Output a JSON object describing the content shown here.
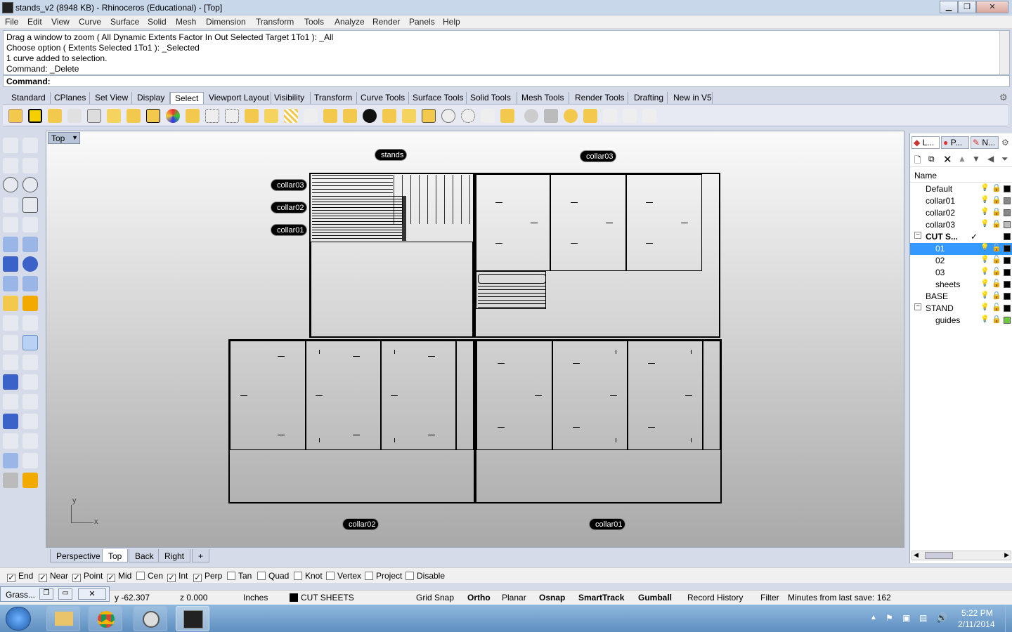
{
  "window": {
    "title": "stands_v2 (8948 KB) - Rhinoceros (Educational) - [Top]"
  },
  "menu": [
    "File",
    "Edit",
    "View",
    "Curve",
    "Surface",
    "Solid",
    "Mesh",
    "Dimension",
    "Transform",
    "Tools",
    "Analyze",
    "Render",
    "Panels",
    "Help"
  ],
  "history": [
    "Drag a window to zoom ( All  Dynamic  Extents  Factor  In  Out  Selected  Target  1To1 ): _All",
    "Choose option ( Extents  Selected  1To1 ): _Selected",
    "1 curve added to selection.",
    "Command: _Delete"
  ],
  "command_label": "Command:",
  "toolbar_tabs": [
    "Standard",
    "CPlanes",
    "Set View",
    "Display",
    "Select",
    "Viewport Layout",
    "Visibility",
    "Transform",
    "Curve Tools",
    "Surface Tools",
    "Solid Tools",
    "Mesh Tools",
    "Render Tools",
    "Drafting",
    "New in V5"
  ],
  "viewport": {
    "label": "Top",
    "labels": {
      "stands": "stands",
      "collar03_top": "collar03",
      "collar03": "collar03",
      "collar02": "collar02",
      "collar01": "collar01",
      "collar02_bottom": "collar02",
      "collar01_bottom": "collar01"
    },
    "axis_y": "y",
    "axis_x": "x"
  },
  "viewport_tabs": [
    "Perspective",
    "Top",
    "Back",
    "Right"
  ],
  "osnaps": [
    {
      "label": "End",
      "checked": true
    },
    {
      "label": "Near",
      "checked": true
    },
    {
      "label": "Point",
      "checked": true
    },
    {
      "label": "Mid",
      "checked": true
    },
    {
      "label": "Cen",
      "checked": false
    },
    {
      "label": "Int",
      "checked": true
    },
    {
      "label": "Perp",
      "checked": true
    },
    {
      "label": "Tan",
      "checked": false
    },
    {
      "label": "Quad",
      "checked": false
    },
    {
      "label": "Knot",
      "checked": false
    },
    {
      "label": "Vertex",
      "checked": false
    },
    {
      "label": "Project",
      "checked": false
    },
    {
      "label": "Disable",
      "checked": false
    }
  ],
  "status": {
    "grasshopper": "Grass...",
    "y": "y -62.307",
    "z": "z 0.000",
    "units": "Inches",
    "layer": "CUT SHEETS",
    "grid_snap": "Grid Snap",
    "ortho": "Ortho",
    "planar": "Planar",
    "osnap": "Osnap",
    "smarttrack": "SmartTrack",
    "gumball": "Gumball",
    "record": "Record History",
    "filter": "Filter",
    "minutes": "Minutes from last save: 162"
  },
  "panel": {
    "tabs": [
      "L...",
      "P...",
      "N..."
    ],
    "name_header": "Name",
    "layers": [
      {
        "name": "Default",
        "indent": 1,
        "color": "#000000",
        "bold": false
      },
      {
        "name": "collar01",
        "indent": 1,
        "color": "#888888",
        "bold": false
      },
      {
        "name": "collar02",
        "indent": 1,
        "color": "#888888",
        "bold": false
      },
      {
        "name": "collar03",
        "indent": 1,
        "color": "#bbbbbb",
        "bold": false
      },
      {
        "name": "CUT S...",
        "indent": 0,
        "color": "#000000",
        "bold": true,
        "current": "✓"
      },
      {
        "name": "01",
        "indent": 2,
        "color": "#000000",
        "selected": true
      },
      {
        "name": "02",
        "indent": 2,
        "color": "#000000"
      },
      {
        "name": "03",
        "indent": 2,
        "color": "#000000"
      },
      {
        "name": "sheets",
        "indent": 2,
        "color": "#000000"
      },
      {
        "name": "BASE",
        "indent": 1,
        "color": "#000000"
      },
      {
        "name": "STAND",
        "indent": 0,
        "color": "#000000"
      },
      {
        "name": "guides",
        "indent": 2,
        "color": "#6ccb3c"
      }
    ]
  },
  "taskbar": {
    "time": "5:22 PM",
    "date": "2/11/2014"
  }
}
